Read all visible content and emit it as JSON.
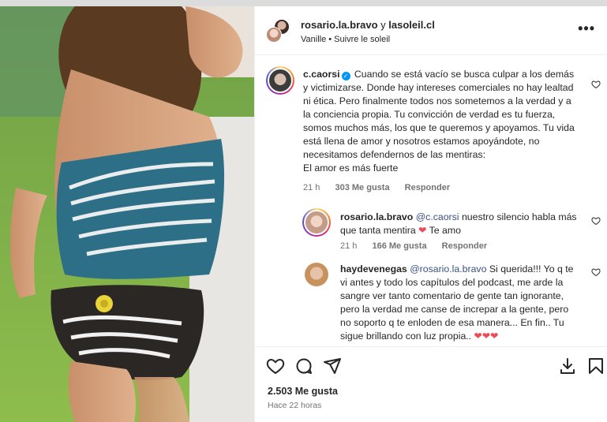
{
  "post": {
    "authors": "rosario.la.bravo y lasoleil.cl",
    "author_main": "rosario.la.bravo",
    "author_join": "y",
    "author_second": "lasoleil.cl",
    "audio": "Vanille • Suivre le soleil",
    "likes": "2.503 Me gusta",
    "time_ago": "Hace 22 horas"
  },
  "comments": [
    {
      "user": "c.caorsi",
      "verified": true,
      "text": "Cuando se está vacío se busca culpar a los demás y victimizarse. Donde hay intereses comerciales no hay lealtad ni ética. Pero finalmente todos nos sometemos a la verdad y a la conciencia propia. Tu convicción de verdad es tu fuerza, somos muchos más, los que te queremos y apoyamos. Tu vida está llena de amor y nosotros estamos apoyándote, no necesitamos defendernos de las mentiras:",
      "text2": "El amor es más fuerte",
      "time": "21 h",
      "likes": "303 Me gusta",
      "reply": "Responder"
    },
    {
      "user": "rosario.la.bravo",
      "mention": "@c.caorsi",
      "text": "nuestro silencio habla más que tanta mentira",
      "emoji": "❤",
      "text_end": "Te amo",
      "time": "21 h",
      "likes": "166 Me gusta",
      "reply": "Responder"
    },
    {
      "user": "haydevenegas",
      "mention": "@rosario.la.bravo",
      "text": "Si querida!!! Yo q te vi antes y todo los capítulos del podcast, me arde la sangre ver tanto comentario de gente tan ignorante, pero la verdad me canse de increpar a la gente, pero no soporto q te enloden de esa manera... En fin.. Tu sigue brillando con luz propia..",
      "emoji": "❤❤❤"
    }
  ],
  "icons": {
    "like": "heart-icon",
    "comment": "comment-icon",
    "share": "share-icon",
    "download": "download-icon",
    "save": "bookmark-icon",
    "more": "more-icon"
  },
  "colors": {
    "verified": "#0095f6",
    "mention": "#385185",
    "heart": "#ed4956",
    "muted": "#737373"
  }
}
